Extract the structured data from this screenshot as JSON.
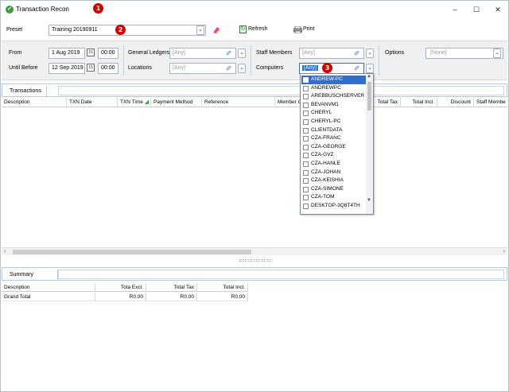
{
  "window": {
    "title": "Transaction Recon",
    "controls": {
      "minimize": "–",
      "maximize": "☐",
      "close": "✕"
    }
  },
  "markers": [
    "1",
    "2",
    "3"
  ],
  "preset": {
    "label": "Preset",
    "value": "Training 20190911",
    "refresh_label": "Refresh",
    "refresh_underline_char": "R",
    "print_label": "Print",
    "print_underline_char": "P"
  },
  "filters": {
    "from_label": "From",
    "from_date": "1 Aug 2019",
    "from_time": "00:00",
    "until_label": "Until Before",
    "until_date": "12 Sep 2019",
    "until_time": "00:00",
    "general_ledgers_label": "General Ledgers",
    "general_ledgers_value": "[Any]",
    "locations_label": "Locations",
    "locations_value": "[Any]",
    "staff_members_label": "Staff Members",
    "staff_members_value": "[Any]",
    "computers_label": "Computers",
    "computers_value": "[Any]",
    "options_label": "Options",
    "options_value": "[None]"
  },
  "transactions": {
    "tab_label": "Transactions",
    "columns": [
      "Description",
      "TXN Date",
      "TXN Time",
      "Payment Method",
      "Reference",
      "Member C",
      "Total Tax",
      "Total Incl.",
      "Discount",
      "Staff Membe"
    ]
  },
  "summary": {
    "tab_label": "Summary",
    "columns": [
      "Description",
      "Tota Excl.",
      "Total Tax",
      "Total Incl."
    ],
    "rows": [
      {
        "description": "Grand Total",
        "excl": "R0.00",
        "tax": "R0.00",
        "incl": "R0.00"
      }
    ]
  },
  "computers_dropdown": {
    "selected": "ANDREW-PC",
    "items": [
      "ANDREW-PC",
      "ANDREWPC",
      "AREBBUSCHSERVER",
      "BEVANVM1",
      "CHERYL",
      "CHERYL-PC",
      "CLIENTDATA",
      "CZA-FRANC",
      "CZA-GEORGE",
      "CZA-GVZ",
      "CZA-HANLE",
      "CZA-JOHAN",
      "CZA-KEISHIA",
      "CZA-SIMONE",
      "CZA-TOM",
      "DESKTOP-3Q8T4TH"
    ]
  },
  "colors": {
    "selection": "#2f6fd0",
    "marker": "#d40000",
    "band": "#eff0f2"
  },
  "icons": {
    "app": "green-check-circle",
    "eraser": "eraser-icon",
    "refresh": "refresh-icon",
    "print": "printer-icon",
    "calendar": "calendar-icon",
    "sort": "sort-ascending-icon"
  }
}
